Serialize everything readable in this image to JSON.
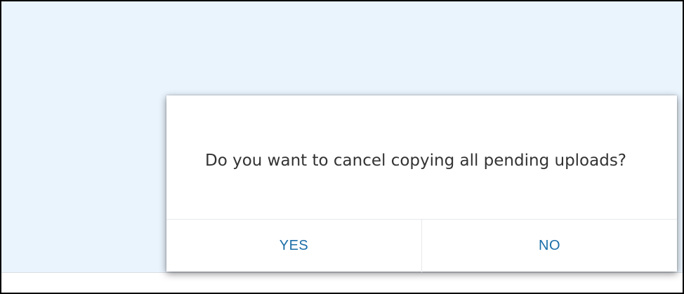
{
  "dialog": {
    "message": "Do you want to cancel copying all pending uploads?",
    "yes_label": "YES",
    "no_label": "NO",
    "accent_color": "#1c6ea8"
  },
  "background": {
    "panel_color": "#eaf4fd"
  }
}
